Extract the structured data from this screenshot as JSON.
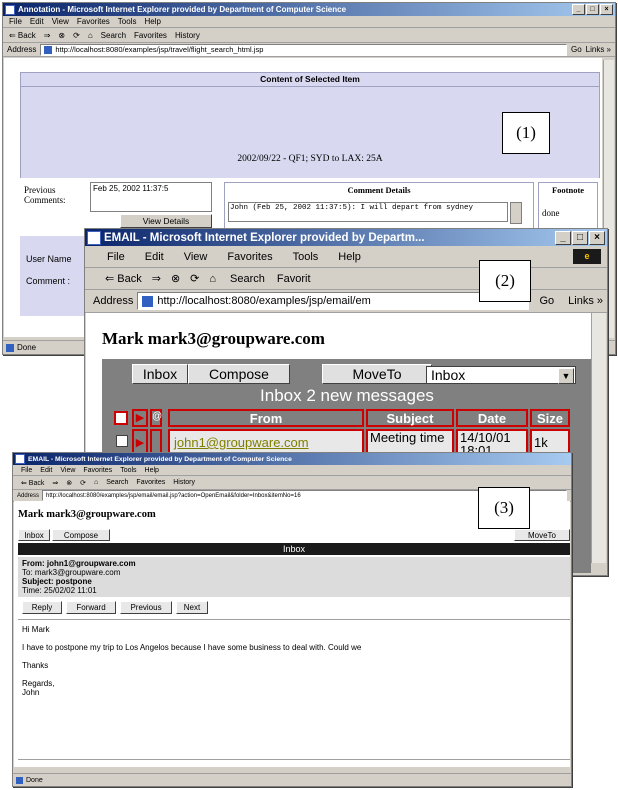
{
  "w1": {
    "title": "Annotation - Microsoft Internet Explorer provided by Department of Computer Science",
    "menu": [
      "File",
      "Edit",
      "View",
      "Favorites",
      "Tools",
      "Help"
    ],
    "toolbar": [
      "⇐ Back",
      "⇒",
      "⊗",
      "⟳",
      "⌂",
      "Search",
      "Favorites",
      "History"
    ],
    "address_label": "Address",
    "address": "http://localhost:8080/examples/jsp/travel/flight_search_html.jsp",
    "go": "Go",
    "links": "Links »",
    "content_header": "Content of Selected Item",
    "content_text": "2002/09/22 - QF1; SYD to LAX: 25A",
    "prev_label": "Previous Comments:",
    "prev_value": "Feb 25, 2002 11:37:5",
    "view_details": "View Details",
    "comment_details_header": "Comment Details",
    "comment_text": "John (Feb 25, 2002 11:37:5): I will depart from sydney",
    "footnote_header": "Footnote",
    "footnote_value": "done",
    "user_name_label": "User Name",
    "comment_label": "Comment :",
    "status": "Done"
  },
  "w2": {
    "title": "EMAIL - Microsoft Internet Explorer provided by Departm...",
    "menu": [
      "File",
      "Edit",
      "View",
      "Favorites",
      "Tools",
      "Help"
    ],
    "back": "⇐ Back",
    "search": "Search",
    "favorites": "Favorit",
    "address_label": "Address",
    "address": "http://localhost:8080/examples/jsp/email/em",
    "go": "Go",
    "links": "Links »",
    "heading": "Mark mark3@groupware.com",
    "tab_inbox": "Inbox",
    "tab_compose": "Compose",
    "tab_moveto": "MoveTo",
    "folder": "Inbox",
    "inbox_banner": "Inbox 2 new messages",
    "columns": [
      "From",
      "Subject",
      "Date",
      "Size"
    ],
    "row": {
      "from": "john1@groupware.com",
      "subject": "Meeting time",
      "date": "14/10/01 18:01",
      "size": "1k"
    }
  },
  "w3": {
    "title": "EMAIL - Microsoft Internet Explorer provided by Department of Computer Science",
    "menu": [
      "File",
      "Edit",
      "View",
      "Favorites",
      "Tools",
      "Help"
    ],
    "toolbar": [
      "⇐ Back",
      "⇒",
      "⊗",
      "⟳",
      "⌂",
      "Search",
      "Favorites",
      "History"
    ],
    "address_label": "Address",
    "address": "http://localhost:8080/examples/jsp/email/email.jsp?action=OpenEmail&folder=Inbox&itemNo=16",
    "heading": "Mark mark3@groupware.com",
    "tab_inbox": "Inbox",
    "tab_compose": "Compose",
    "tab_moveto": "MoveTo",
    "banner": "Inbox",
    "from": "From: john1@groupware.com",
    "to": "To: mark3@groupware.com",
    "subject": "Subject: postpone",
    "time": "Time: 25/02/02 11:01",
    "btn_reply": "Reply",
    "btn_forward": "Forward",
    "btn_previous": "Previous",
    "btn_next": "Next",
    "greeting": "Hi Mark",
    "body": "I have to postpone my trip to Los Angelos because I have some business to deal with. Could we",
    "thanks": "Thanks",
    "regards": "Regards,",
    "signature": "John",
    "status": "Done"
  },
  "callouts": [
    "(1)",
    "(2)",
    "(3)"
  ],
  "colors": {
    "title_blue": "#0a246a",
    "panel_lavender": "#d8d8f0",
    "email_gray": "#808080",
    "email_red": "#cc0000",
    "link_olive": "#808000"
  }
}
